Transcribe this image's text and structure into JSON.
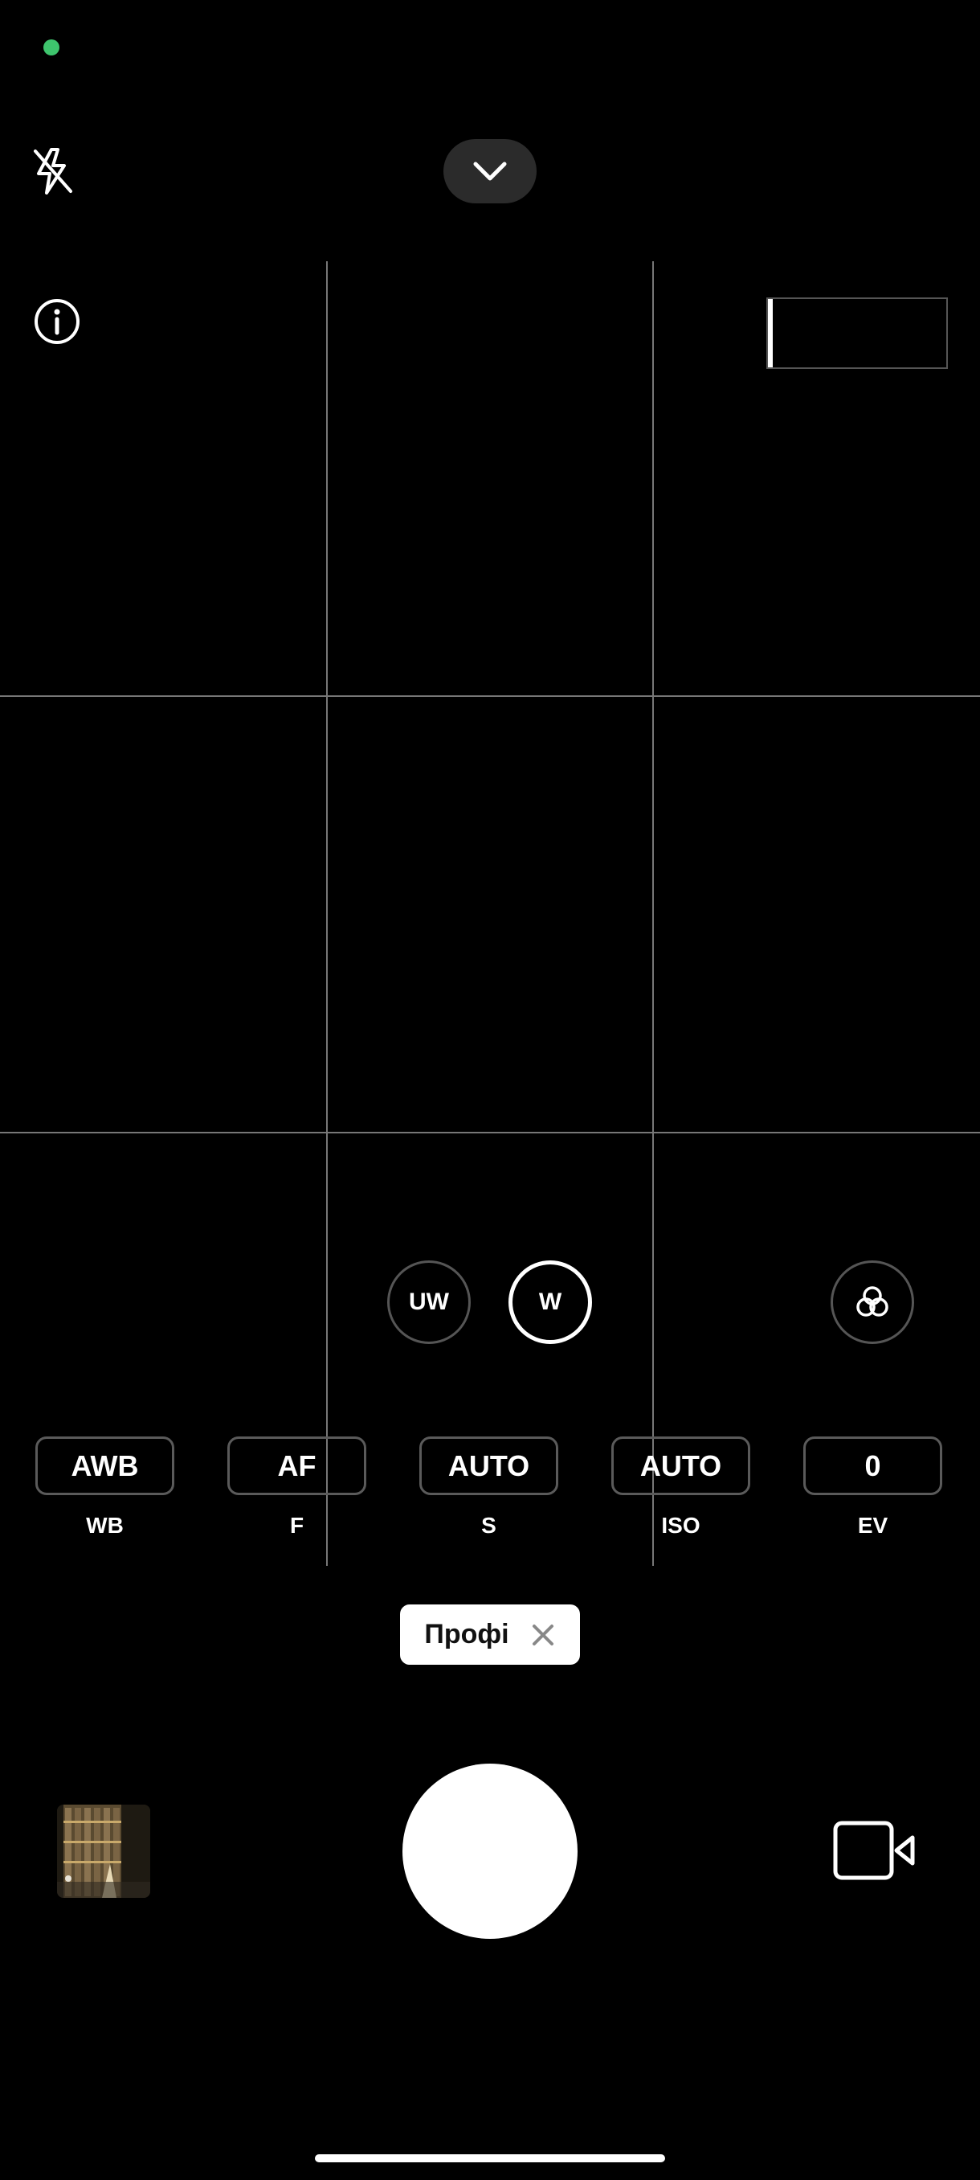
{
  "status": {
    "indicator_color": "#3ec46d"
  },
  "top_controls": {
    "flash_icon": "flash-off-icon",
    "collapse_icon": "chevron-down-icon",
    "info_icon": "info-icon"
  },
  "lenses": {
    "items": [
      {
        "label": "UW",
        "selected": false
      },
      {
        "label": "W",
        "selected": true
      }
    ],
    "filter_icon": "filters-icon"
  },
  "pro_controls": [
    {
      "value": "AWB",
      "label": "WB"
    },
    {
      "value": "AF",
      "label": "F"
    },
    {
      "value": "AUTO",
      "label": "S"
    },
    {
      "value": "AUTO",
      "label": "ISO"
    },
    {
      "value": "0",
      "label": "EV"
    }
  ],
  "mode_chip": {
    "label": "Профі",
    "close_icon": "close-icon"
  },
  "bottom_bar": {
    "gallery_icon": "gallery-thumbnail",
    "shutter_icon": "shutter-button",
    "video_icon": "video-camera-icon"
  }
}
